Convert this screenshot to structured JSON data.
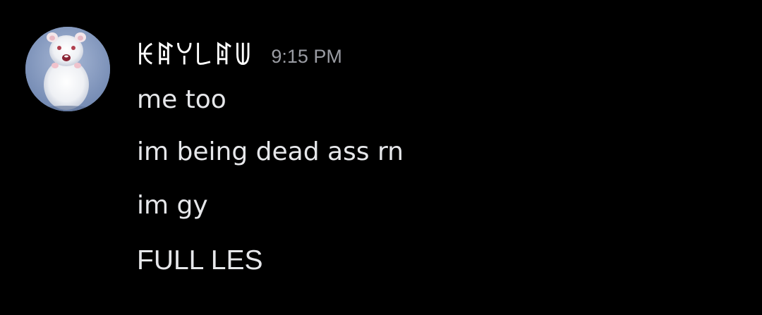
{
  "message": {
    "author": {
      "display_name": "ꀘꍏꌩ꒒ꍏꅐ",
      "avatar_icon": "hamster-avatar-icon"
    },
    "timestamp": "9:15 PM",
    "lines": [
      "me too",
      "im being dead ass rn",
      "im gy",
      "FULL LES"
    ]
  },
  "colors": {
    "background": "#000000",
    "username": "#ffffff",
    "timestamp": "#9a9ca3",
    "message_text": "#e6e7ea",
    "avatar_background": "#7d93b8"
  }
}
